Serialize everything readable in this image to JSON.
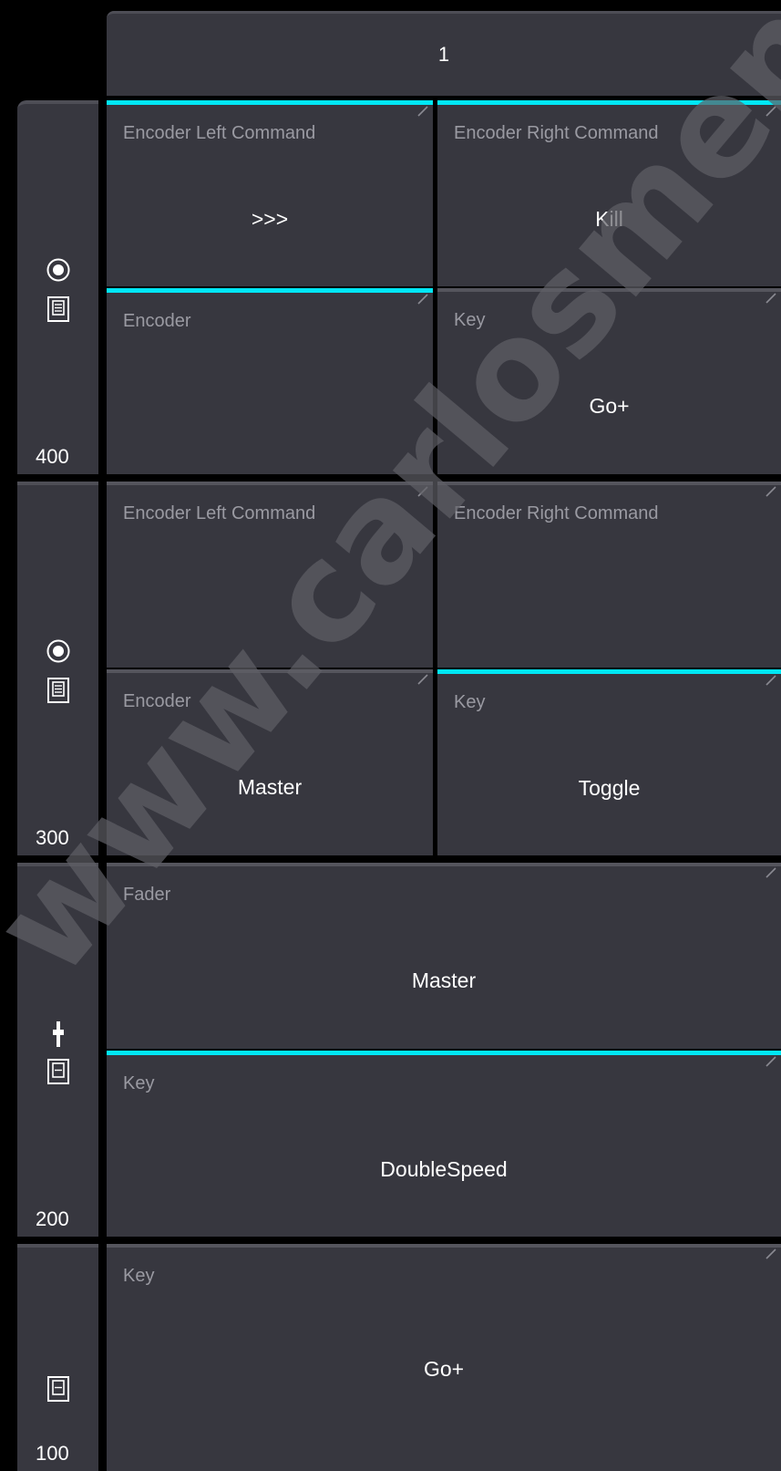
{
  "header": {
    "title": "1"
  },
  "icons": {
    "encoder": "encoder-knob-icon",
    "key": "key-button-icon",
    "fader": "fader-icon"
  },
  "colors": {
    "background": "#000000",
    "panel": "#37373f",
    "active_accent": "#00e7f5",
    "label": "#9a9aa2",
    "value": "#ffffff"
  },
  "executors": [
    {
      "number": "400",
      "icons": [
        "encoder-knob-icon",
        "key-button-icon"
      ],
      "cells": [
        {
          "label": "Encoder Left Command",
          "value": ">>>",
          "active": true
        },
        {
          "label": "Encoder Right Command",
          "value": "Kill",
          "active": true
        },
        {
          "label": "Encoder",
          "value": "",
          "active": true
        },
        {
          "label": "Key",
          "value": "Go+",
          "active": false
        }
      ]
    },
    {
      "number": "300",
      "icons": [
        "encoder-knob-icon",
        "key-button-icon"
      ],
      "cells": [
        {
          "label": "Encoder Left Command",
          "value": "",
          "active": false
        },
        {
          "label": "Encoder Right Command",
          "value": "",
          "active": false
        },
        {
          "label": "Encoder",
          "value": "Master",
          "active": false
        },
        {
          "label": "Key",
          "value": "Toggle",
          "active": true
        }
      ]
    },
    {
      "number": "200",
      "icons": [
        "fader-icon",
        "key-button-icon"
      ],
      "cells": [
        {
          "label": "Fader",
          "value": "Master",
          "active": false
        },
        {
          "label": "Key",
          "value": "DoubleSpeed",
          "active": true
        }
      ]
    },
    {
      "number": "100",
      "icons": [
        "key-button-icon"
      ],
      "cells": [
        {
          "label": "Key",
          "value": "Go+",
          "active": false
        }
      ]
    }
  ],
  "watermark": "www.carlosmendoza"
}
